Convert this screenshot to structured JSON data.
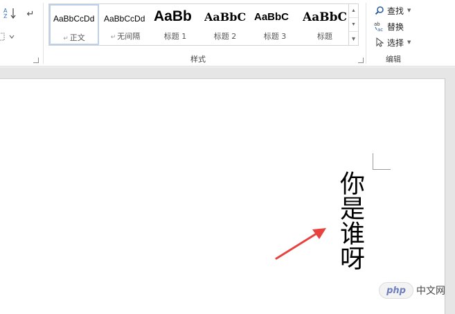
{
  "ribbon": {
    "styles_gallery": {
      "items": [
        {
          "preview": "AaBbCcDd",
          "name": "正文",
          "selected": true,
          "has_pilcrow": true
        },
        {
          "preview": "AaBbCcDd",
          "name": "无间隔",
          "selected": false,
          "has_pilcrow": true
        },
        {
          "preview": "AaBb",
          "name": "标题 1",
          "selected": false,
          "has_pilcrow": false
        },
        {
          "preview": "AaBbC",
          "name": "标题 2",
          "selected": false,
          "has_pilcrow": false
        },
        {
          "preview": "AaBbC",
          "name": "标题 3",
          "selected": false,
          "has_pilcrow": false
        },
        {
          "preview": "AaBbC",
          "name": "标题",
          "selected": false,
          "has_pilcrow": false
        }
      ],
      "group_label": "样式",
      "scroll_up": "▲",
      "scroll_down": "▼",
      "more": "▾"
    },
    "editing": {
      "find_label": "查找",
      "replace_label": "替换",
      "select_label": "选择",
      "group_label": "编辑",
      "caret": "▼"
    },
    "paragraph_fragment": {
      "sort_icon_glyph": "A↓",
      "pilcrow_glyph": "↵"
    }
  },
  "document": {
    "vertical_text": "你是谁呀"
  },
  "annotation": {
    "arrow_color": "#e8423f"
  },
  "watermark": {
    "logo_text": "php",
    "site_text": "中文网"
  }
}
